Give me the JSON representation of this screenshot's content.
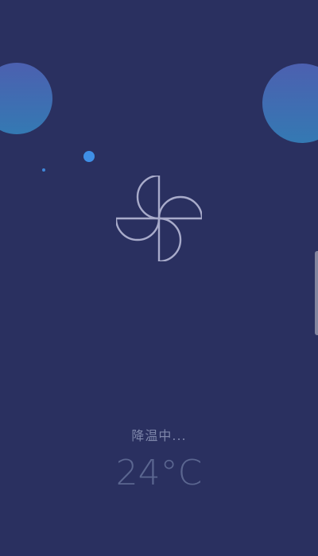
{
  "screen": {
    "background_color": "#2a3060",
    "bubble_color_top": "#4c60b0",
    "bubble_color_bottom": "#3479b3",
    "accent_dot_color": "#3f8fe6"
  },
  "fan": {
    "icon": "pinwheel-fan-icon",
    "stroke_color": "#a8abca"
  },
  "status": {
    "text": "降温中..."
  },
  "temperature": {
    "value": "24°C"
  }
}
